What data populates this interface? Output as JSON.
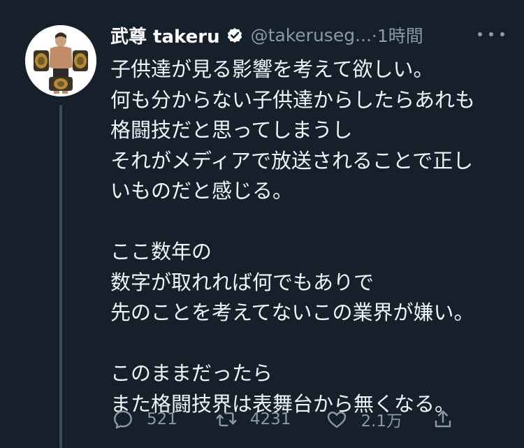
{
  "tweet": {
    "author_name": "武尊 takeru",
    "handle": "@takeruseg...",
    "time": "·1時間",
    "lines": [
      "子供達が見る影響を考えて欲しい。",
      "何も分からない子供達からしたらあれも",
      "格闘技だと思ってしまうし",
      "それがメディアで放送されることで正し",
      "いものだと感じる。",
      "",
      "ここ数年の",
      "数字が取れれば何でもありで",
      "先のことを考えてないこの業界が嫌い。",
      "",
      "このままだったら",
      "また格闘技界は表舞台から無くなる。"
    ]
  },
  "actions": {
    "reply_count": "521",
    "retweet_count": "4231",
    "like_count": "2.1万"
  },
  "icons": {
    "verified": "verified-badge-icon",
    "more": "more-icon",
    "reply": "reply-icon",
    "retweet": "retweet-icon",
    "like": "heart-icon",
    "share": "share-icon"
  },
  "colors": {
    "background": "#15202b",
    "secondary_text": "#8b98a5",
    "thread_line": "#3d4a57"
  }
}
